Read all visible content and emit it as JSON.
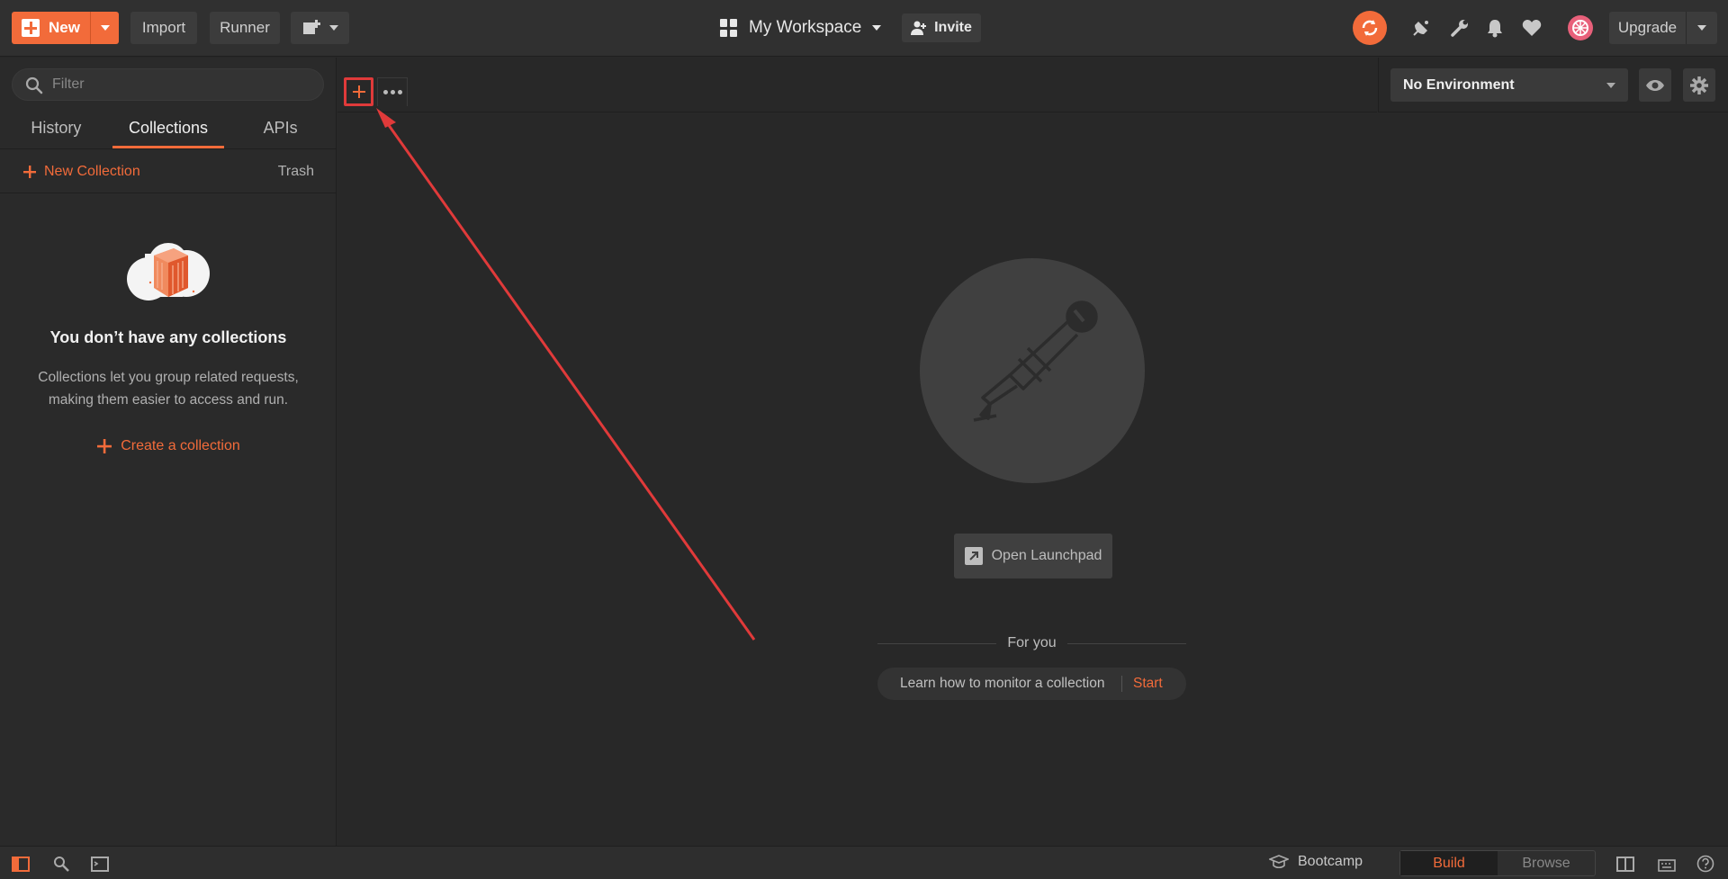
{
  "header": {
    "new_label": "New",
    "import_label": "Import",
    "runner_label": "Runner",
    "workspace_label": "My Workspace",
    "invite_label": "Invite",
    "upgrade_label": "Upgrade"
  },
  "sidebar": {
    "filter_placeholder": "Filter",
    "tabs": [
      {
        "label": "History"
      },
      {
        "label": "Collections",
        "active": true
      },
      {
        "label": "APIs"
      }
    ],
    "new_collection_label": "New Collection",
    "trash_label": "Trash",
    "empty_title": "You don’t have any collections",
    "empty_desc": "Collections let you group related requests, making them easier to access and run.",
    "create_label": "Create a collection"
  },
  "environment": {
    "selected": "No Environment"
  },
  "main": {
    "launchpad_label": "Open Launchpad",
    "for_you_label": "For you",
    "suggestion_text": "Learn how to monitor a collection",
    "suggestion_action": "Start"
  },
  "statusbar": {
    "bootcamp_label": "Bootcamp",
    "build_label": "Build",
    "browse_label": "Browse"
  },
  "colors": {
    "accent": "#f26b3a",
    "annotation": "#e03a3a"
  }
}
